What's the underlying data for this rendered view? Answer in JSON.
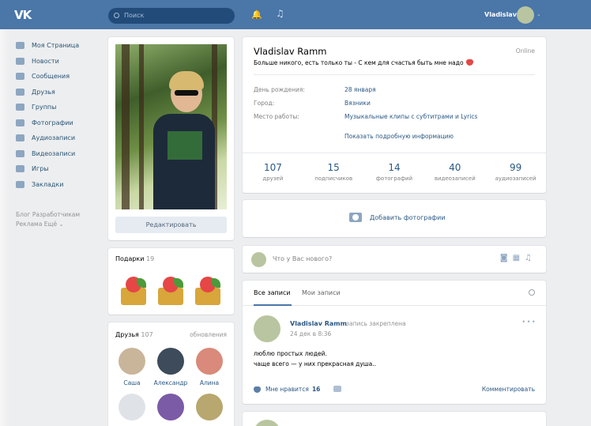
{
  "topbar": {
    "logo": "VK",
    "search_placeholder": "Поиск",
    "username": "Vladislav",
    "caret": "⌄"
  },
  "nav": [
    {
      "label": "Моя Страница",
      "icon": "home-icon"
    },
    {
      "label": "Новости",
      "icon": "news-icon"
    },
    {
      "label": "Сообщения",
      "icon": "messages-icon"
    },
    {
      "label": "Друзья",
      "icon": "friends-icon"
    },
    {
      "label": "Группы",
      "icon": "groups-icon"
    },
    {
      "label": "Фотографии",
      "icon": "camera-icon"
    },
    {
      "label": "Аудиозаписи",
      "icon": "music-icon"
    },
    {
      "label": "Видеозаписи",
      "icon": "video-icon"
    },
    {
      "label": "Игры",
      "icon": "gamepad-icon"
    },
    {
      "label": "Закладки",
      "icon": "star-icon"
    }
  ],
  "nav_footer": {
    "line1": "Блог   Разработчикам",
    "line2": "Реклама   Ещё ⌄"
  },
  "profile": {
    "edit_button": "Редактировать",
    "name": "Vladislav Ramm",
    "online": "Online",
    "status": "Больше никого, есть только ты - С кем для счастья быть мне надо",
    "rows": [
      {
        "label": "День рождения:",
        "value": "28 января"
      },
      {
        "label": "Город:",
        "value": "Вязники"
      },
      {
        "label": "Место работы:",
        "value": "Музыкальные клипы с субтитрами и Lyrics"
      }
    ],
    "more_info": "Показать подробную информацию",
    "counters": [
      {
        "num": "107",
        "cap": "друзей"
      },
      {
        "num": "15",
        "cap": "подписчиков"
      },
      {
        "num": "14",
        "cap": "фотографий"
      },
      {
        "num": "40",
        "cap": "видеозаписей"
      },
      {
        "num": "99",
        "cap": "аудиозаписей"
      }
    ]
  },
  "add_photo": "Добавить фотографии",
  "gifts": {
    "title": "Подарки",
    "count": "19"
  },
  "friends": {
    "title": "Друзья",
    "count": "107",
    "updates": "обновления",
    "list": [
      {
        "name": "Саша"
      },
      {
        "name": "Александр"
      },
      {
        "name": "Алина"
      }
    ]
  },
  "compose": {
    "placeholder": "Что у Вас нового?"
  },
  "wall": {
    "tabs": [
      "Все записи",
      "Мои записи"
    ],
    "post": {
      "author": "Vladislav Ramm",
      "pinned": "запись закреплена",
      "date": "24 дек в 8:36",
      "text_line1": "люблю простых людей.",
      "text_line2": "чаще всего — у них прекрасная душа..",
      "like_label": "Мне нравится",
      "like_count": "16",
      "comment_label": "Комментировать"
    }
  },
  "colors": {
    "header": "#4a76a8",
    "link": "#2a5885",
    "background": "#edeef0"
  }
}
